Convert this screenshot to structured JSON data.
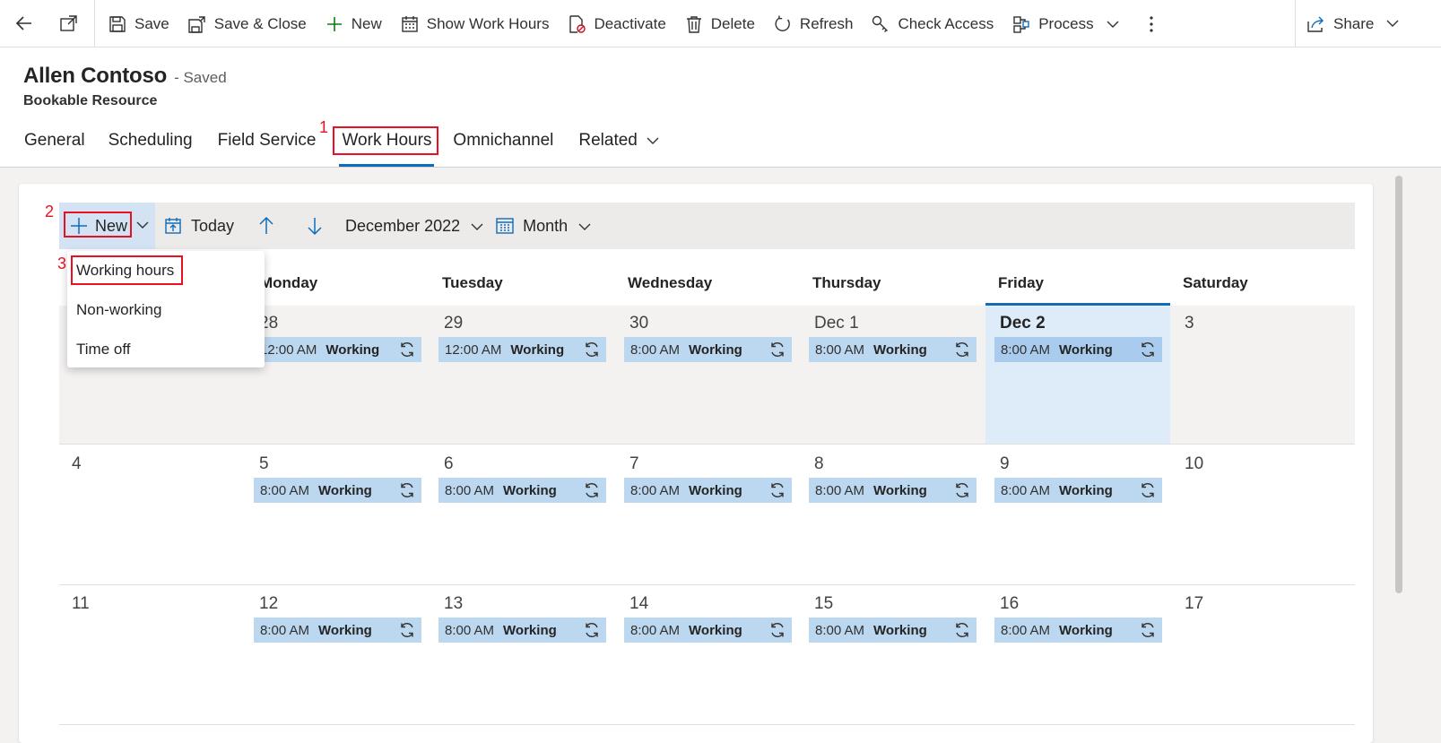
{
  "commandbar": {
    "items": [
      {
        "label": "Save",
        "icon": "save-icon"
      },
      {
        "label": "Save & Close",
        "icon": "save-close-icon"
      },
      {
        "label": "New",
        "icon": "plus-icon"
      },
      {
        "label": "Show Work Hours",
        "icon": "calendar-icon"
      },
      {
        "label": "Deactivate",
        "icon": "deactivate-icon"
      },
      {
        "label": "Delete",
        "icon": "trash-icon"
      },
      {
        "label": "Refresh",
        "icon": "refresh-icon"
      },
      {
        "label": "Check Access",
        "icon": "key-icon"
      },
      {
        "label": "Process",
        "icon": "process-icon"
      }
    ],
    "share_label": "Share"
  },
  "record": {
    "name": "Allen Contoso",
    "status": "- Saved",
    "entity": "Bookable Resource"
  },
  "tabs": [
    "General",
    "Scheduling",
    "Field Service",
    "Work Hours",
    "Omnichannel",
    "Related"
  ],
  "active_tab": "Work Hours",
  "annotations": [
    "1",
    "2",
    "3"
  ],
  "calendar": {
    "toolbar": {
      "new_label": "New",
      "today_label": "Today",
      "period_label": "December 2022",
      "view_label": "Month"
    },
    "new_menu": [
      "Working hours",
      "Non-working",
      "Time off"
    ],
    "days": [
      "Monday",
      "Tuesday",
      "Wednesday",
      "Thursday",
      "Friday",
      "Saturday"
    ],
    "weeks": [
      {
        "dates": [
          "",
          "28",
          "29",
          "30",
          "Dec 1",
          "Dec 2",
          "3"
        ],
        "events": [
          "",
          "12:00 AM",
          "12:00 AM",
          "8:00 AM",
          "8:00 AM",
          "8:00 AM",
          ""
        ]
      },
      {
        "dates": [
          "4",
          "5",
          "6",
          "7",
          "8",
          "9",
          "10"
        ],
        "events": [
          "",
          "8:00 AM",
          "8:00 AM",
          "8:00 AM",
          "8:00 AM",
          "8:00 AM",
          ""
        ]
      },
      {
        "dates": [
          "11",
          "12",
          "13",
          "14",
          "15",
          "16",
          "17"
        ],
        "events": [
          "",
          "8:00 AM",
          "8:00 AM",
          "8:00 AM",
          "8:00 AM",
          "8:00 AM",
          ""
        ]
      }
    ],
    "event_status": "Working",
    "today_date": "Dec 2"
  },
  "colors": {
    "accent": "#0f6cbd",
    "annotation_red": "#e81123",
    "event_bg": "#bcd8f1",
    "today_bg": "#deecf9"
  }
}
